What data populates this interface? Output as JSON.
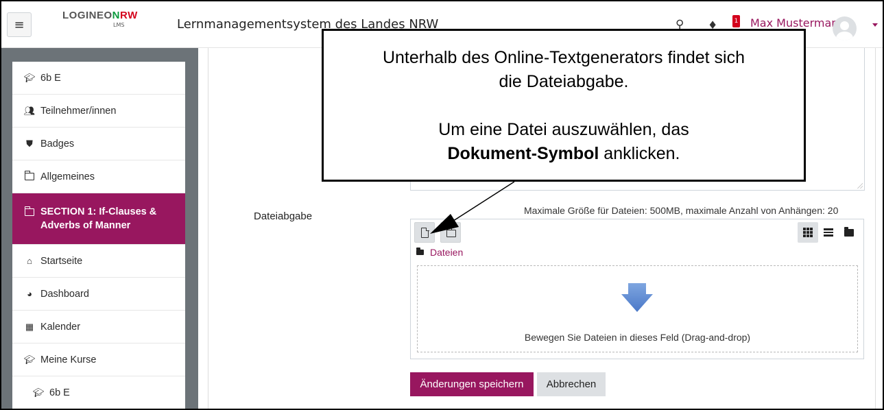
{
  "header": {
    "logo_part1": "LOGINEO",
    "logo_part2": "N",
    "logo_part3": "RW",
    "logo_sub": "LMS",
    "site_name": "Lernmanagementsystem des Landes NRW",
    "notification_count": "1",
    "user_name": "Max Mustermann",
    "icons": [
      "menu-icon",
      "search-icon",
      "bell-icon",
      "chevron-down-icon"
    ]
  },
  "sidebar": {
    "items": [
      {
        "label": "6b E",
        "icon": "graduation-cap-icon"
      },
      {
        "label": "Teilnehmer/innen",
        "icon": "users-icon"
      },
      {
        "label": "Badges",
        "icon": "shield-icon"
      },
      {
        "label": "Allgemeines",
        "icon": "folder-icon"
      },
      {
        "label": "SECTION 1: If-Clauses & Adverbs of Manner",
        "icon": "folder-icon",
        "active": true
      },
      {
        "label": "Startseite",
        "icon": "home-icon"
      },
      {
        "label": "Dashboard",
        "icon": "dashboard-icon"
      },
      {
        "label": "Kalender",
        "icon": "calendar-icon"
      },
      {
        "label": "Meine Kurse",
        "icon": "graduation-cap-icon"
      },
      {
        "label": "6b E",
        "icon": "graduation-cap-icon"
      }
    ]
  },
  "form": {
    "file_label": "Dateiabgabe",
    "max_info": "Maximale Größe für Dateien: 500MB, maximale Anzahl von Anhängen: 20",
    "path_label": "Dateien",
    "drop_text": "Bewegen Sie Dateien in dieses Feld (Drag-and-drop)",
    "save_label": "Änderungen speichern",
    "cancel_label": "Abbrechen"
  },
  "callout": {
    "line1": "Unterhalb des Online-Textgenerators findet sich",
    "line2": "die Dateiabgabe.",
    "line3": "Um eine Datei auszuwählen, das",
    "line4_bold": "Dokument-Symbol",
    "line4_rest": " anklicken."
  },
  "colors": {
    "accent": "#98175f",
    "drawer_bg": "#6c7378",
    "button_grey": "#dde0e3"
  }
}
